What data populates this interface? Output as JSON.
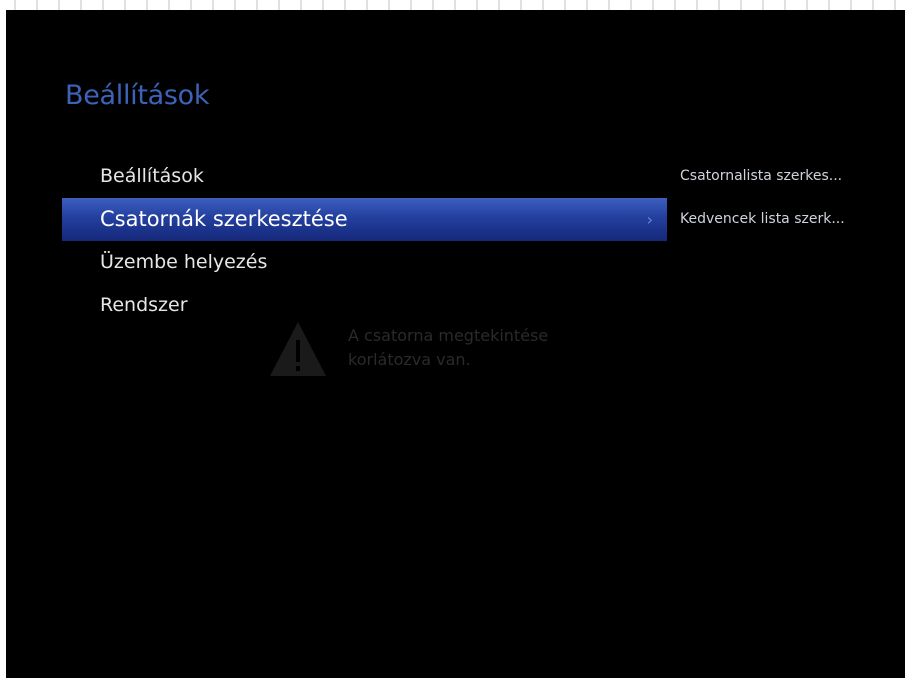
{
  "screen": {
    "title": "Beállítások"
  },
  "menu": {
    "items": [
      {
        "label": "Beállítások",
        "selected": false
      },
      {
        "label": "Csatornák szerkesztése",
        "selected": true,
        "chevron": "›"
      },
      {
        "label": "Üzembe helyezés",
        "selected": false
      },
      {
        "label": "Rendszer",
        "selected": false
      }
    ]
  },
  "submenu": {
    "items": [
      {
        "label": "Csatornalista szerkes..."
      },
      {
        "label": "Kedvencek lista szerk..."
      }
    ]
  },
  "warning": {
    "icon": "warning-triangle-icon",
    "line1": "A csatorna megtekintése",
    "line2": "korlátozva van."
  },
  "colors": {
    "background": "#000000",
    "title": "#3c63b8",
    "selection": "#233f9e",
    "text": "#e6e6e6"
  }
}
